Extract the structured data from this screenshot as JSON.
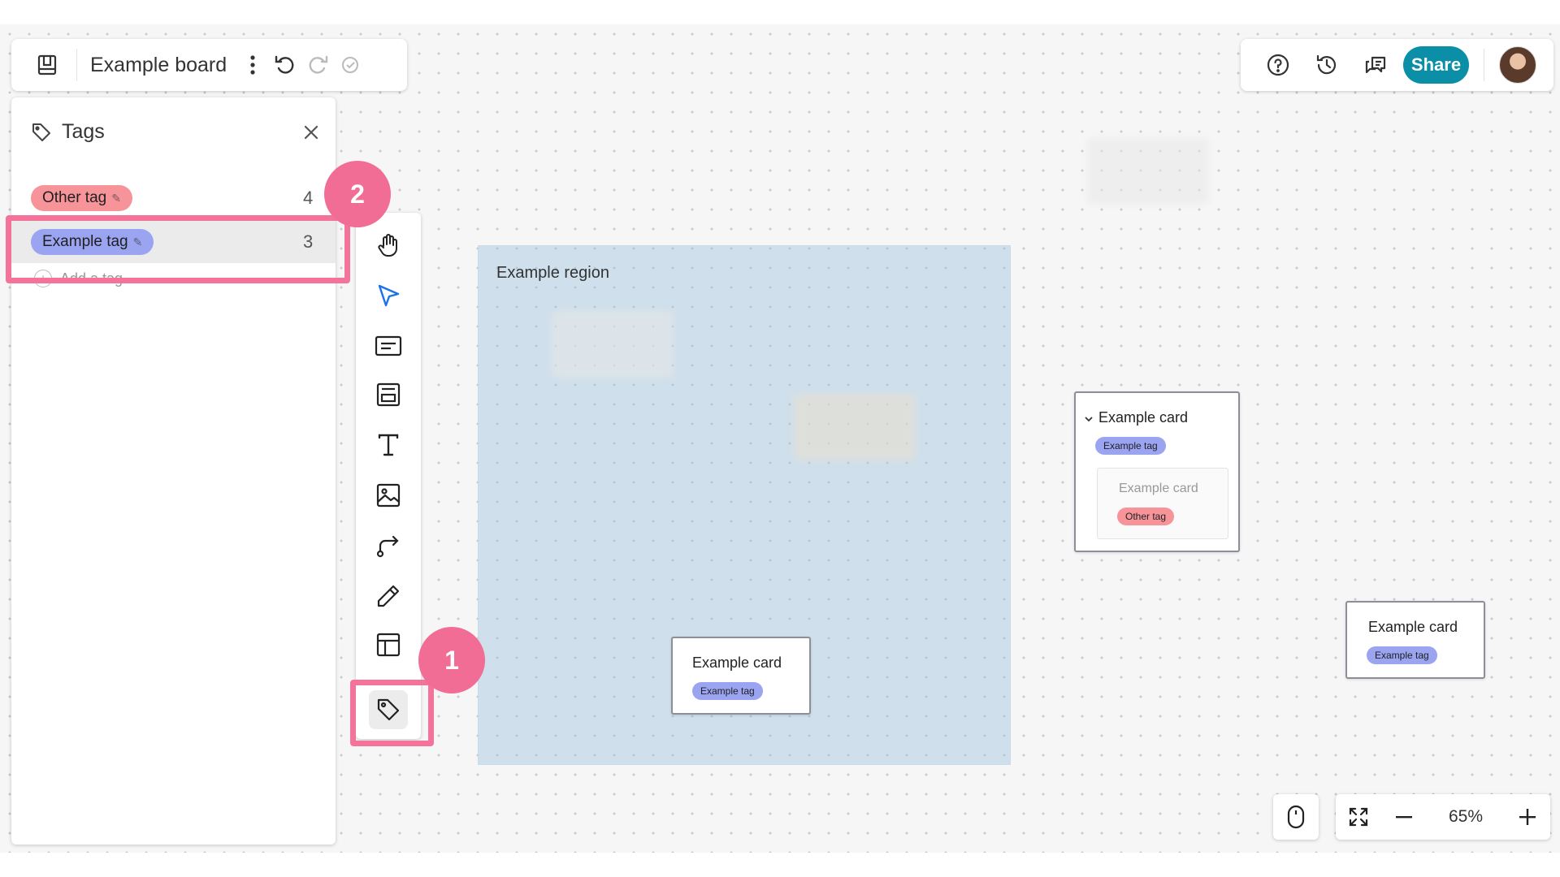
{
  "header": {
    "board_title": "Example board",
    "share_label": "Share"
  },
  "tags_panel": {
    "title": "Tags",
    "tags": [
      {
        "label": "Other tag",
        "count": "4",
        "color": "#f6949a"
      },
      {
        "label": "Example tag",
        "count": "3",
        "color": "#9aa4f1"
      }
    ],
    "add_tag_label": "Add a tag"
  },
  "toolbar": {
    "tools": [
      "hand-icon",
      "select-arrow-icon",
      "card-icon",
      "region-icon",
      "text-icon",
      "image-icon",
      "connector-icon",
      "pen-icon",
      "template-icon",
      "tag-icon"
    ]
  },
  "callouts": {
    "badge_1": "1",
    "badge_2": "2",
    "color": "#f16d95"
  },
  "canvas": {
    "region_title": "Example region",
    "cards": [
      {
        "title": "Example card",
        "tag": "Example tag"
      },
      {
        "title": "Example card",
        "tag": "Example tag",
        "child_title": "Example card",
        "child_tag": "Other tag"
      },
      {
        "title": "Example card",
        "tag": "Example tag"
      }
    ]
  },
  "zoom": {
    "level": "65%"
  },
  "colors": {
    "accent": "#0a8fa6",
    "example_tag": "#9aa4f1",
    "other_tag": "#f6949a",
    "highlight": "#f4739a"
  }
}
